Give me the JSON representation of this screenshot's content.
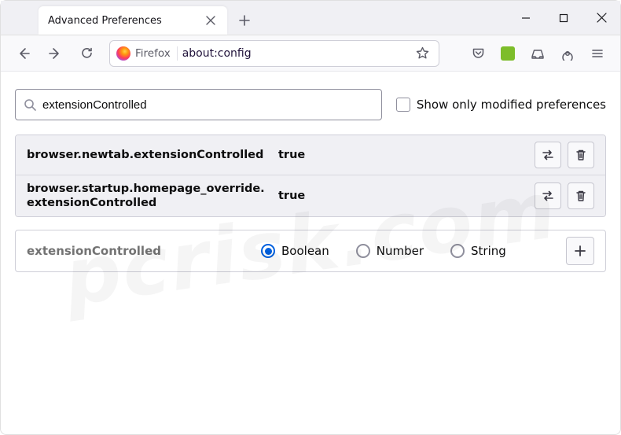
{
  "window": {
    "tab_title": "Advanced Preferences",
    "identity_label": "Firefox",
    "url": "about:config"
  },
  "search": {
    "value": "extensionControlled",
    "show_modified_label": "Show only modified preferences"
  },
  "prefs": [
    {
      "name": "browser.newtab.extensionControlled",
      "value": "true"
    },
    {
      "name": "browser.startup.homepage_override.extensionControlled",
      "value": "true"
    }
  ],
  "new_pref": {
    "name": "extensionControlled",
    "types": [
      "Boolean",
      "Number",
      "String"
    ],
    "selected": "Boolean"
  }
}
